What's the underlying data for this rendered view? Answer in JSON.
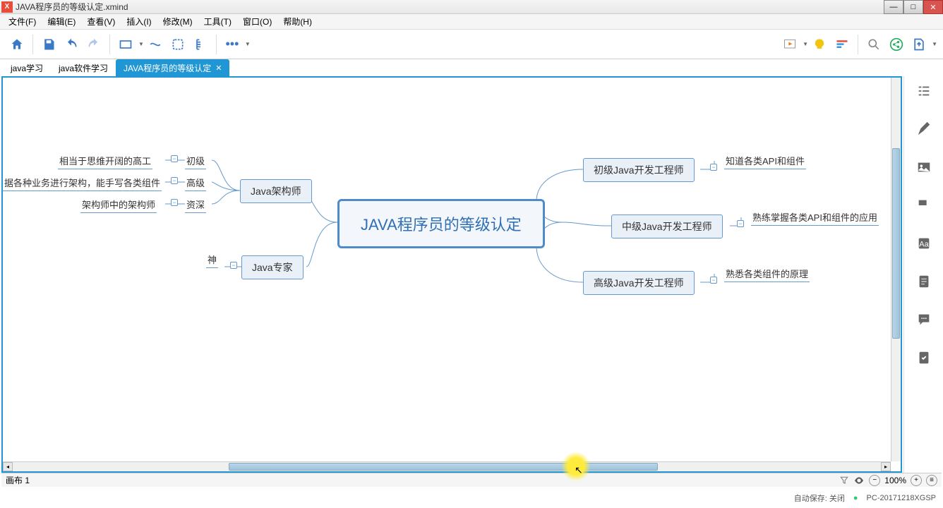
{
  "window": {
    "title": "JAVA程序员的等级认定.xmind"
  },
  "menu": {
    "file": "文件(F)",
    "edit": "编辑(E)",
    "view": "查看(V)",
    "insert": "插入(I)",
    "modify": "修改(M)",
    "tools": "工具(T)",
    "window": "窗口(O)",
    "help": "帮助(H)"
  },
  "tabs": {
    "t1": "java学习",
    "t2": "java软件学习",
    "t3": "JAVA程序员的等级认定"
  },
  "map": {
    "central": "JAVA程序员的等级认定",
    "r1": "初级Java开发工程师",
    "r1a": "知道各类API和组件",
    "r2": "中级Java开发工程师",
    "r2a": "熟练掌握各类API和组件的应用",
    "r3": "高级Java开发工程师",
    "r3a": "熟悉各类组件的原理",
    "l1": "Java架构师",
    "l1a": "初级",
    "l1a_d": "相当于思维开阔的高工",
    "l1b": "高级",
    "l1b_d": "据各种业务进行架构，能手写各类组件",
    "l1c": "资深",
    "l1c_d": "架构师中的架构师",
    "l2": "Java专家",
    "l2a": "神"
  },
  "status": {
    "sheet": "画布 1",
    "zoom": "100%"
  },
  "footer": {
    "autosave": "自动保存: 关闭",
    "host": "PC-20171218XGSP"
  }
}
